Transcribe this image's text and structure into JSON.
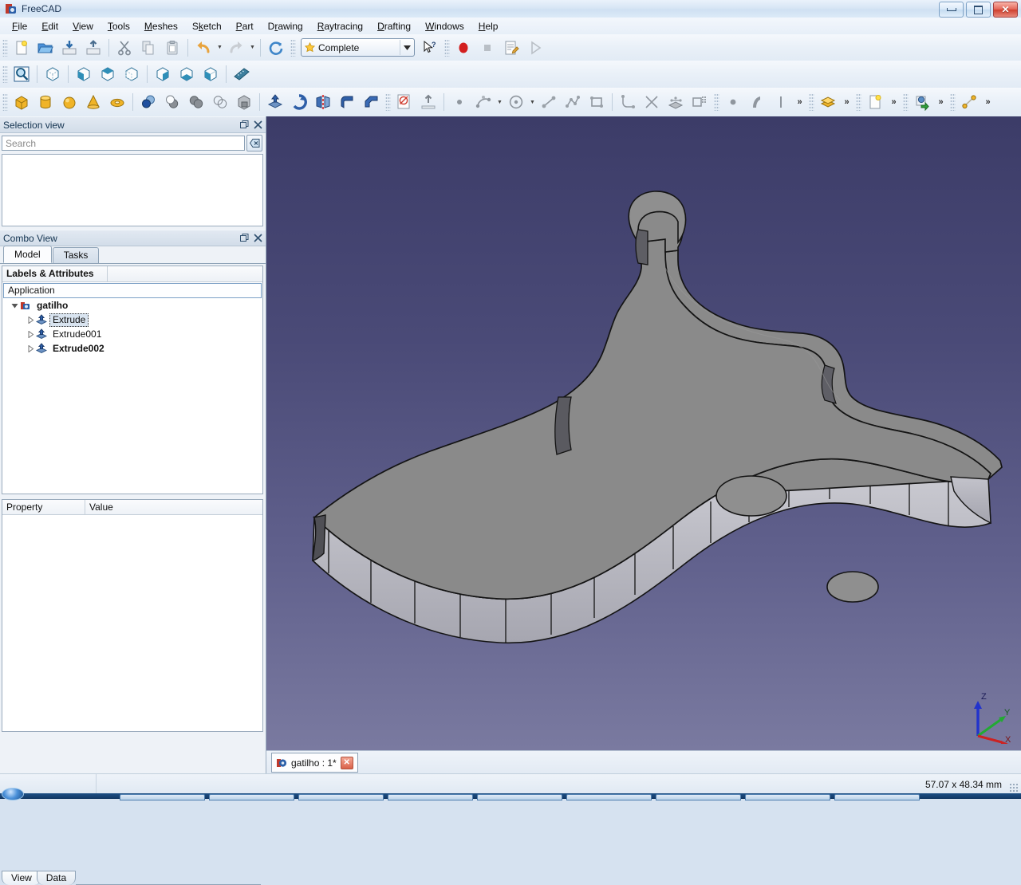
{
  "window": {
    "title": "FreeCAD",
    "icon": "freecad-icon",
    "minimize_label": "Minimize",
    "maximize_label": "Maximize",
    "close_label": "Close"
  },
  "menu": {
    "items": [
      {
        "label": "File",
        "accel": "F"
      },
      {
        "label": "Edit",
        "accel": "E"
      },
      {
        "label": "View",
        "accel": "V"
      },
      {
        "label": "Tools",
        "accel": "T"
      },
      {
        "label": "Meshes",
        "accel": "M"
      },
      {
        "label": "Sketch",
        "accel": "S"
      },
      {
        "label": "Part",
        "accel": "P"
      },
      {
        "label": "Drawing",
        "accel": "D"
      },
      {
        "label": "Raytracing",
        "accel": "R"
      },
      {
        "label": "Drafting",
        "accel": "D"
      },
      {
        "label": "Windows",
        "accel": "W"
      },
      {
        "label": "Help",
        "accel": "H"
      }
    ]
  },
  "toolbars": {
    "file": [
      {
        "name": "new-document-icon",
        "label": "New"
      },
      {
        "name": "open-document-icon",
        "label": "Open"
      },
      {
        "name": "save-document-icon",
        "label": "Save"
      },
      {
        "name": "print-document-icon",
        "label": "Print"
      }
    ],
    "edit": [
      {
        "name": "cut-icon",
        "label": "Cut"
      },
      {
        "name": "copy-icon",
        "label": "Copy"
      },
      {
        "name": "paste-icon",
        "label": "Paste"
      },
      {
        "name": "undo-icon",
        "label": "Undo"
      },
      {
        "name": "redo-icon",
        "label": "Redo"
      },
      {
        "name": "refresh-icon",
        "label": "Refresh"
      }
    ],
    "workbench": {
      "selected": "Complete",
      "icon": "star-icon",
      "dropdown_icon": "chevron-down-icon"
    },
    "whats_this": {
      "name": "whats-this-icon",
      "label": "What's This?"
    },
    "macro": [
      {
        "name": "macro-record-icon",
        "label": "Macro recording"
      },
      {
        "name": "macro-stop-icon",
        "label": "Stop macro recording"
      },
      {
        "name": "macro-edit-icon",
        "label": "Macros"
      },
      {
        "name": "macro-execute-icon",
        "label": "Execute macro"
      }
    ],
    "view": [
      {
        "name": "fit-all-icon",
        "label": "Fit all"
      },
      {
        "name": "axonometric-view-icon",
        "label": "Axonometric"
      },
      {
        "name": "front-view-icon",
        "label": "Front"
      },
      {
        "name": "top-view-icon",
        "label": "Top"
      },
      {
        "name": "right-view-icon",
        "label": "Right"
      },
      {
        "name": "rear-view-icon",
        "label": "Rear"
      },
      {
        "name": "bottom-view-icon",
        "label": "Bottom"
      },
      {
        "name": "left-view-icon",
        "label": "Left"
      },
      {
        "name": "measure-icon",
        "label": "Measure"
      }
    ],
    "part_primitives": [
      {
        "name": "box-icon",
        "label": "Box"
      },
      {
        "name": "cylinder-icon",
        "label": "Cylinder"
      },
      {
        "name": "sphere-icon",
        "label": "Sphere"
      },
      {
        "name": "cone-icon",
        "label": "Cone"
      },
      {
        "name": "torus-icon",
        "label": "Torus"
      }
    ],
    "part_boolean": [
      {
        "name": "boolean-icon",
        "label": "Boolean"
      },
      {
        "name": "cut-shape-icon",
        "label": "Cut"
      },
      {
        "name": "union-shape-icon",
        "label": "Union"
      },
      {
        "name": "intersection-shape-icon",
        "label": "Intersection"
      },
      {
        "name": "section-shape-icon",
        "label": "Section"
      }
    ],
    "part_modify": [
      {
        "name": "extrude-icon",
        "label": "Extrude"
      },
      {
        "name": "revolve-icon",
        "label": "Revolve"
      },
      {
        "name": "mirror-icon",
        "label": "Mirror"
      },
      {
        "name": "fillet-icon",
        "label": "Fillet"
      },
      {
        "name": "chamfer-icon",
        "label": "Chamfer"
      }
    ],
    "sketcher": [
      {
        "name": "new-sketch-icon",
        "label": "Create sketch"
      },
      {
        "name": "leave-sketch-icon",
        "label": "Leave sketch"
      },
      {
        "name": "sketch-point-icon",
        "label": "Point"
      },
      {
        "name": "sketch-arc-icon",
        "label": "Arc"
      },
      {
        "name": "sketch-circle-icon",
        "label": "Circle"
      },
      {
        "name": "sketch-line-icon",
        "label": "Line"
      },
      {
        "name": "sketch-polyline-icon",
        "label": "Polyline"
      },
      {
        "name": "sketch-rectangle-icon",
        "label": "Rectangle"
      },
      {
        "name": "sketch-fillet-icon",
        "label": "Sketch fillet"
      },
      {
        "name": "sketch-trim-icon",
        "label": "Trim edge"
      },
      {
        "name": "sketch-external-icon",
        "label": "External geometry"
      },
      {
        "name": "sketch-clone-icon",
        "label": "Clone"
      }
    ],
    "constraints": [
      {
        "name": "constraint-point-icon",
        "label": "Coincident"
      },
      {
        "name": "constraint-tangent-icon",
        "label": "Tangent"
      },
      {
        "name": "constraint-vertical-icon",
        "label": "Vertical"
      }
    ],
    "overflow_icon": "chevron-double-right-icon",
    "extra_groups": [
      {
        "name": "structure-icon",
        "label": "Structure"
      },
      {
        "name": "new-page-icon",
        "label": "New page"
      },
      {
        "name": "import-icon",
        "label": "Import"
      },
      {
        "name": "draft-line-icon",
        "label": "Draft line"
      }
    ]
  },
  "selection_view": {
    "title": "Selection view",
    "float_icon": "float-panel-icon",
    "close_icon": "close-panel-icon",
    "search": {
      "value": "",
      "placeholder": "Search"
    },
    "clear_icon": "clear-search-icon",
    "items": []
  },
  "combo_view": {
    "title": "Combo View",
    "float_icon": "float-panel-icon",
    "close_icon": "close-panel-icon",
    "tabs": [
      {
        "label": "Model",
        "active": true
      },
      {
        "label": "Tasks",
        "active": false
      }
    ],
    "tree_header": {
      "labels": "Labels & Attributes",
      "description": ""
    },
    "tree": {
      "root": "Application",
      "document": {
        "label": "gatilho",
        "icon": "document-icon",
        "bold": true,
        "expanded": true
      },
      "children": [
        {
          "label": "Extrude",
          "icon": "extrude-feature-icon",
          "selected": true,
          "bold": false
        },
        {
          "label": "Extrude001",
          "icon": "extrude-feature-icon",
          "selected": false,
          "bold": false
        },
        {
          "label": "Extrude002",
          "icon": "extrude-feature-icon",
          "selected": false,
          "bold": true
        }
      ]
    },
    "property_editor": {
      "columns": [
        "Property",
        "Value"
      ],
      "rows": []
    },
    "bottom_tabs": [
      {
        "label": "View",
        "active": true
      },
      {
        "label": "Data",
        "active": false
      }
    ]
  },
  "viewport": {
    "background_top": "#3c3c68",
    "background_bottom": "#7a7aa0",
    "model_face_color": "#8a8a8a",
    "model_side_color": "#b4b4bd",
    "model_dark_color": "#6d6d6d",
    "outline_color": "#101010",
    "axis_indicator": {
      "x": {
        "label": "X",
        "color": "#cc2222"
      },
      "y": {
        "label": "Y",
        "color": "#22aa33"
      },
      "z": {
        "label": "Z",
        "color": "#2233cc"
      }
    }
  },
  "document_tabs": [
    {
      "label": "gatilho : 1*",
      "icon": "freecad-icon",
      "close_icon": "close-tab-icon",
      "active": true
    }
  ],
  "status_bar": {
    "message": "",
    "dimensions": "57.07 x 48.34 mm"
  },
  "taskbar": {
    "start_label": "Start"
  }
}
